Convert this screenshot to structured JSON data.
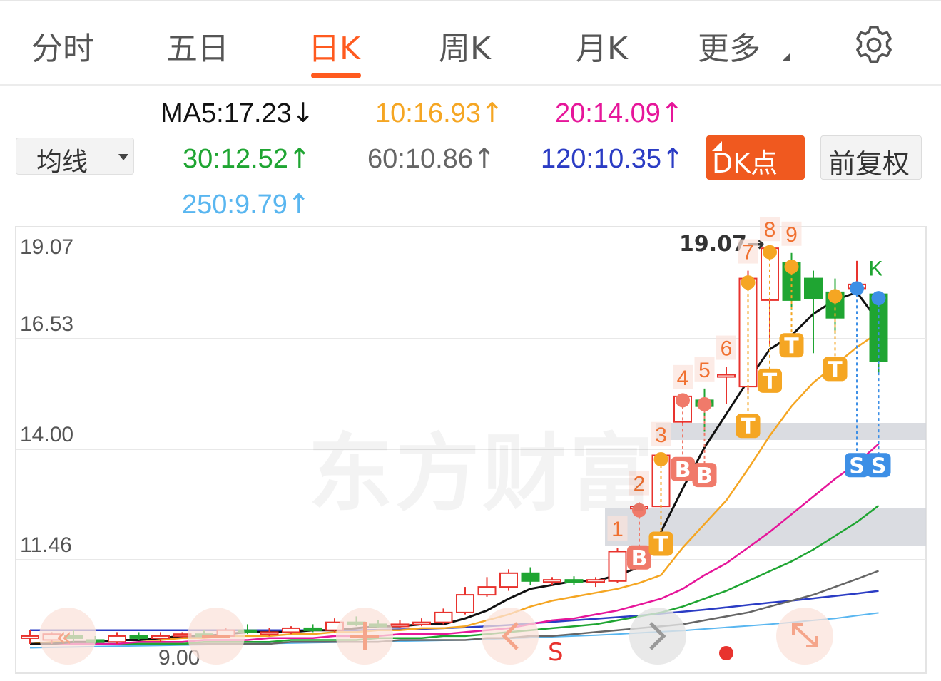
{
  "tabs": [
    {
      "label": "分时",
      "active": false
    },
    {
      "label": "五日",
      "active": false
    },
    {
      "label": "日K",
      "active": true
    },
    {
      "label": "周K",
      "active": false
    },
    {
      "label": "月K",
      "active": false
    },
    {
      "label": "更多",
      "active": false
    }
  ],
  "settings_icon": "gear-icon",
  "ma_selector": {
    "label": "均线"
  },
  "ma_values": {
    "ma5": "MA5:17.23",
    "ma5_arrow": "↓",
    "ma10": "10:16.93",
    "ma10_arrow": "↑",
    "ma20": "20:14.09",
    "ma20_arrow": "↑",
    "ma30": "30:12.52",
    "ma30_arrow": "↑",
    "ma60": "60:10.86",
    "ma60_arrow": "↑",
    "ma120": "120:10.35",
    "ma120_arrow": "↑",
    "ma250": "250:9.79",
    "ma250_arrow": "↑"
  },
  "buttons": {
    "dk": "DK点",
    "adjust": "前复权"
  },
  "watermark": "东方财富",
  "colors": {
    "accent": "#ff5a1f",
    "up": "#e8332e",
    "down": "#1fa532",
    "ma5": "#111111",
    "ma10": "#f5a623",
    "ma20": "#e6169a",
    "ma30": "#1fa532",
    "ma60": "#666666",
    "ma120": "#2b3cc4",
    "ma250": "#59b6f0"
  },
  "chart_data": {
    "type": "candlestick",
    "yticks": [
      "19.07",
      "16.53",
      "14.00",
      "11.46"
    ],
    "ylim": [
      8.6,
      19.4
    ],
    "high_label": "19.07→",
    "low_label": "9.00",
    "candles": [
      {
        "o": 9.15,
        "h": 9.35,
        "l": 9.0,
        "c": 9.2
      },
      {
        "o": 9.1,
        "h": 9.3,
        "l": 9.0,
        "c": 9.25
      },
      {
        "o": 9.2,
        "h": 9.35,
        "l": 9.05,
        "c": 9.15
      },
      {
        "o": 9.1,
        "h": 9.2,
        "l": 9.0,
        "c": 9.05
      },
      {
        "o": 9.05,
        "h": 9.3,
        "l": 9.0,
        "c": 9.2
      },
      {
        "o": 9.2,
        "h": 9.3,
        "l": 9.1,
        "c": 9.15
      },
      {
        "o": 9.15,
        "h": 9.3,
        "l": 9.05,
        "c": 9.2
      },
      {
        "o": 9.2,
        "h": 9.3,
        "l": 9.15,
        "c": 9.25
      },
      {
        "o": 9.25,
        "h": 9.35,
        "l": 9.15,
        "c": 9.2
      },
      {
        "o": 9.2,
        "h": 9.4,
        "l": 9.15,
        "c": 9.35
      },
      {
        "o": 9.35,
        "h": 9.5,
        "l": 9.25,
        "c": 9.3
      },
      {
        "o": 9.3,
        "h": 9.4,
        "l": 9.2,
        "c": 9.3
      },
      {
        "o": 9.3,
        "h": 9.45,
        "l": 9.25,
        "c": 9.4
      },
      {
        "o": 9.4,
        "h": 9.5,
        "l": 9.3,
        "c": 9.35
      },
      {
        "o": 9.35,
        "h": 9.65,
        "l": 9.3,
        "c": 9.55
      },
      {
        "o": 9.55,
        "h": 9.7,
        "l": 9.45,
        "c": 9.5
      },
      {
        "o": 9.5,
        "h": 9.6,
        "l": 9.4,
        "c": 9.45
      },
      {
        "o": 9.45,
        "h": 9.6,
        "l": 9.4,
        "c": 9.5
      },
      {
        "o": 9.5,
        "h": 9.65,
        "l": 9.45,
        "c": 9.55
      },
      {
        "o": 9.55,
        "h": 9.9,
        "l": 9.5,
        "c": 9.8
      },
      {
        "o": 9.8,
        "h": 10.45,
        "l": 9.75,
        "c": 10.25
      },
      {
        "o": 10.25,
        "h": 10.7,
        "l": 10.2,
        "c": 10.45
      },
      {
        "o": 10.45,
        "h": 10.9,
        "l": 10.35,
        "c": 10.8
      },
      {
        "o": 10.8,
        "h": 10.95,
        "l": 10.5,
        "c": 10.6
      },
      {
        "o": 10.6,
        "h": 10.7,
        "l": 10.5,
        "c": 10.63
      },
      {
        "o": 10.63,
        "h": 10.72,
        "l": 10.5,
        "c": 10.6
      },
      {
        "o": 10.6,
        "h": 10.7,
        "l": 10.45,
        "c": 10.63
      },
      {
        "o": 10.6,
        "h": 11.45,
        "l": 10.55,
        "c": 11.35
      },
      {
        "o": 12.45,
        "h": 12.6,
        "l": 12.3,
        "c": 12.5
      },
      {
        "o": 12.5,
        "h": 13.85,
        "l": 12.45,
        "c": 13.8
      },
      {
        "o": 14.65,
        "h": 15.3,
        "l": 14.55,
        "c": 15.3
      },
      {
        "o": 15.2,
        "h": 15.5,
        "l": 14.4,
        "c": 15.05
      },
      {
        "o": 15.85,
        "h": 16.05,
        "l": 15.1,
        "c": 15.85
      },
      {
        "o": 15.55,
        "h": 18.5,
        "l": 15.45,
        "c": 18.3
      },
      {
        "o": 17.75,
        "h": 19.07,
        "l": 16.6,
        "c": 19.07
      },
      {
        "o": 18.7,
        "h": 18.95,
        "l": 17.5,
        "c": 17.75
      },
      {
        "o": 18.3,
        "h": 18.5,
        "l": 16.4,
        "c": 17.8
      },
      {
        "o": 17.95,
        "h": 18.3,
        "l": 16.9,
        "c": 17.3
      },
      {
        "o": 18.05,
        "h": 18.75,
        "l": 17.85,
        "c": 18.15
      },
      {
        "o": 17.9,
        "h": 17.95,
        "l": 15.85,
        "c": 16.2
      }
    ],
    "ma5": [
      9.0,
      9.0,
      9.05,
      9.05,
      9.1,
      9.1,
      9.15,
      9.2,
      9.2,
      9.25,
      9.3,
      9.3,
      9.3,
      9.35,
      9.35,
      9.4,
      9.45,
      9.45,
      9.5,
      9.5,
      9.65,
      9.85,
      10.15,
      10.4,
      10.5,
      10.6,
      10.6,
      10.75,
      10.95,
      11.85,
      12.95,
      14.0,
      14.85,
      15.7,
      16.5,
      16.85,
      17.4,
      17.75,
      17.95,
      17.2
    ],
    "ma10": [
      9.0,
      9.05,
      9.05,
      9.05,
      9.1,
      9.1,
      9.1,
      9.15,
      9.15,
      9.2,
      9.2,
      9.2,
      9.25,
      9.25,
      9.3,
      9.3,
      9.35,
      9.35,
      9.4,
      9.4,
      9.45,
      9.6,
      9.75,
      9.95,
      10.1,
      10.2,
      10.3,
      10.4,
      10.55,
      10.75,
      11.45,
      12.05,
      12.65,
      13.45,
      14.3,
      15.05,
      15.65,
      16.1,
      16.55,
      16.93
    ],
    "ma20": [
      9.0,
      9.0,
      9.0,
      9.0,
      9.0,
      9.05,
      9.05,
      9.05,
      9.1,
      9.1,
      9.1,
      9.15,
      9.15,
      9.15,
      9.2,
      9.2,
      9.2,
      9.25,
      9.25,
      9.25,
      9.3,
      9.35,
      9.4,
      9.5,
      9.6,
      9.65,
      9.75,
      9.85,
      10.0,
      10.15,
      10.4,
      10.75,
      11.05,
      11.45,
      11.85,
      12.3,
      12.75,
      13.2,
      13.6,
      14.09
    ],
    "ma30": [
      9.0,
      9.0,
      9.0,
      9.0,
      9.0,
      9.0,
      9.0,
      9.0,
      9.05,
      9.05,
      9.05,
      9.05,
      9.1,
      9.1,
      9.1,
      9.1,
      9.15,
      9.15,
      9.15,
      9.2,
      9.2,
      9.25,
      9.3,
      9.35,
      9.4,
      9.45,
      9.5,
      9.6,
      9.7,
      9.8,
      9.95,
      10.15,
      10.35,
      10.6,
      10.85,
      11.1,
      11.4,
      11.75,
      12.1,
      12.52
    ],
    "ma60": [
      9.0,
      9.0,
      9.0,
      9.0,
      9.0,
      9.0,
      9.0,
      9.0,
      9.0,
      9.0,
      9.0,
      9.0,
      9.05,
      9.05,
      9.05,
      9.05,
      9.05,
      9.1,
      9.1,
      9.1,
      9.1,
      9.15,
      9.15,
      9.2,
      9.2,
      9.25,
      9.3,
      9.35,
      9.4,
      9.45,
      9.5,
      9.6,
      9.7,
      9.8,
      9.95,
      10.1,
      10.25,
      10.45,
      10.65,
      10.86
    ],
    "ma120": [
      9.35,
      9.35,
      9.35,
      9.35,
      9.35,
      9.35,
      9.35,
      9.35,
      9.35,
      9.35,
      9.35,
      9.35,
      9.35,
      9.35,
      9.35,
      9.35,
      9.36,
      9.37,
      9.38,
      9.4,
      9.42,
      9.45,
      9.48,
      9.52,
      9.56,
      9.6,
      9.64,
      9.68,
      9.72,
      9.77,
      9.82,
      9.87,
      9.93,
      9.99,
      10.05,
      10.1,
      10.16,
      10.22,
      10.28,
      10.35
    ],
    "ma250": [
      8.9,
      8.91,
      8.92,
      8.93,
      8.94,
      8.95,
      8.96,
      8.97,
      8.98,
      8.99,
      9.0,
      9.01,
      9.02,
      9.03,
      9.04,
      9.05,
      9.06,
      9.07,
      9.08,
      9.09,
      9.1,
      9.12,
      9.14,
      9.16,
      9.18,
      9.2,
      9.22,
      9.25,
      9.28,
      9.31,
      9.34,
      9.38,
      9.42,
      9.46,
      9.5,
      9.55,
      9.6,
      9.65,
      9.72,
      9.79
    ],
    "count_labels": [
      {
        "i": 27,
        "label": "1"
      },
      {
        "i": 28,
        "label": "2"
      },
      {
        "i": 29,
        "label": "3"
      },
      {
        "i": 30,
        "label": "4"
      },
      {
        "i": 31,
        "label": "5"
      },
      {
        "i": 32,
        "label": "6"
      },
      {
        "i": 33,
        "label": "7"
      },
      {
        "i": 34,
        "label": "8"
      },
      {
        "i": 35,
        "label": "9"
      }
    ],
    "signals": [
      {
        "i": 28,
        "label": "B",
        "color": "#f07a6a"
      },
      {
        "i": 29,
        "label": "T",
        "color": "#f5a623"
      },
      {
        "i": 30,
        "label": "B",
        "color": "#f07a6a"
      },
      {
        "i": 31,
        "label": "B",
        "color": "#f07a6a"
      },
      {
        "i": 33,
        "label": "T",
        "color": "#f5a623"
      },
      {
        "i": 34,
        "label": "T",
        "color": "#f5a623"
      },
      {
        "i": 35,
        "label": "T",
        "color": "#f5a623"
      },
      {
        "i": 37,
        "label": "T",
        "color": "#f5a623"
      },
      {
        "i": 38,
        "label": "S",
        "color": "#3d8fe6"
      },
      {
        "i": 39,
        "label": "S",
        "color": "#3d8fe6"
      }
    ],
    "k_label": "K",
    "s_label": "S"
  }
}
